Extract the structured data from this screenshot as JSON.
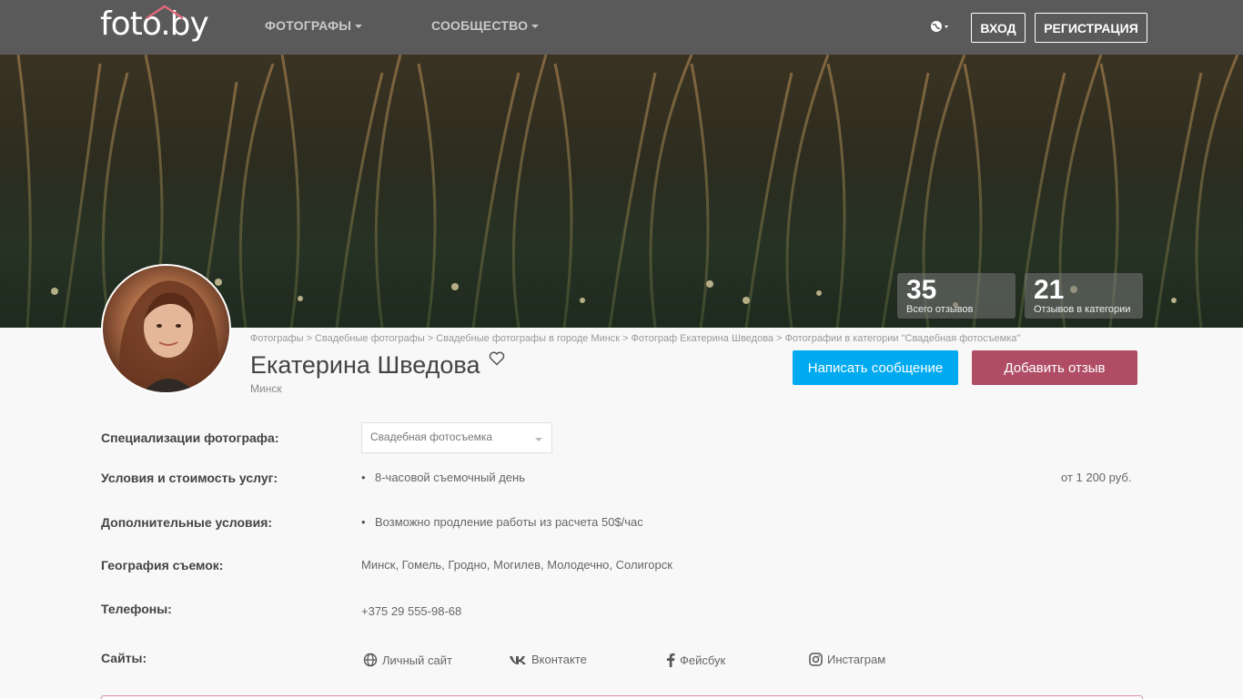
{
  "header": {
    "logo": "foto.by",
    "nav": [
      {
        "label": "ФОТОГРАФЫ"
      },
      {
        "label": "СООБЩЕСТВО"
      }
    ],
    "login_label": "ВХОД",
    "register_label": "РЕГИСТРАЦИЯ"
  },
  "stats": [
    {
      "value": "35",
      "label": "Всего отзывов"
    },
    {
      "value": "21",
      "label": "Отзывов в категории"
    }
  ],
  "breadcrumbs": [
    "Фотографы",
    "Свадебные фотографы",
    "Свадебные фотографы в городе Минск",
    "Фотограф Екатерина Шведова",
    "Фотографии в категории \"Свадебная фотосъемка\""
  ],
  "profile": {
    "name": "Екатерина Шведова",
    "city": "Минск"
  },
  "actions": {
    "message_label": "Написать сообщение",
    "review_label": "Добавить отзыв"
  },
  "info": {
    "specialization_label": "Специализации фотографа:",
    "specialization_value": "Свадебная фотосъемка",
    "terms_label": "Условия и стоимость услуг:",
    "terms_item": "8-часовой съемочный день",
    "terms_price": "от 1 200 руб.",
    "extra_label": "Дополнительные условия:",
    "extra_item": "Возможно продление работы из расчета 50$/час",
    "geo_label": "География съемок:",
    "geo_value": "Минск, Гомель, Гродно, Могилев, Молодечно, Солигорск",
    "phones_label": "Телефоны:",
    "phones_value": "+375 29 555-98-68",
    "sites_label": "Сайты:",
    "sites": [
      {
        "label": "Личный сайт",
        "icon": "globe-icon"
      },
      {
        "label": "Вконтакте",
        "icon": "vk-icon"
      },
      {
        "label": "Фейсбук",
        "icon": "facebook-icon"
      },
      {
        "label": "Инстаграм",
        "icon": "instagram-icon"
      }
    ]
  },
  "colors": {
    "nav_bg": "#5a5a5a",
    "message_btn": "#00aaf0",
    "review_btn": "#b04d64"
  }
}
